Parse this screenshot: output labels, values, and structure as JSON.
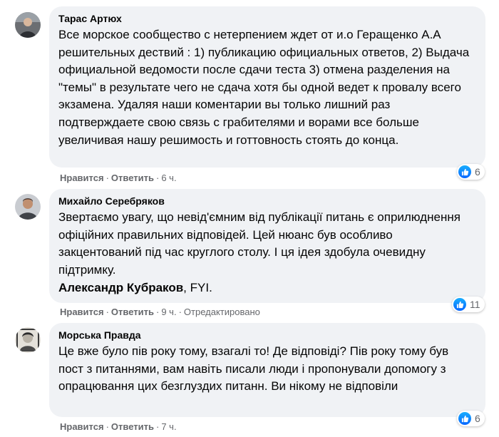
{
  "comments": [
    {
      "author": "Тарас Артюх",
      "text": "Все морское сообщество с нетерпением ждет от и.о Геращенко А.А решительных дествий : 1) публикацию официальных ответов, 2) Выдача официальной ведомости после сдачи теста 3) отмена разделения на \"темы\" в результате чего не сдача хотя бы одной ведет к провалу всего экзамена. Удаляя наши коментарии вы только лишний раз подтверждаете свою связь с грабителями и ворами все больше увеличивая нашу решимость и готтовность стоять до конца.",
      "like_label": "Нравится",
      "reply_label": "Ответить",
      "time": "6 ч.",
      "edited": "",
      "reactions": "6",
      "reaction_icon": "like-icon"
    },
    {
      "author": "Михайло Серебряков",
      "text": "Звертаємо увагу, що невід'ємним від публікації питань є оприлюднення офіційних правильних відповідей. Цей нюанс був особливо закцентований під час круглого столу. І ця ідея здобула очевидну підтримку.",
      "mention": "Александр Кубраков",
      "mention_suffix": ", FYI.",
      "like_label": "Нравится",
      "reply_label": "Ответить",
      "time": "9 ч.",
      "edited": "Отредактировано",
      "reactions": "11",
      "reaction_icon": "like-icon"
    },
    {
      "author": "Морська Правда",
      "text": "Це вже було пів року тому, взагалі то! Де відповіді? Пів року тому був пост з питаннями, вам навіть писали люди і пропонували допомогу з опрацювання цих безглуздих питанн. Ви нікому не відповіли",
      "like_label": "Нравится",
      "reply_label": "Ответить",
      "time": "7 ч.",
      "edited": "",
      "reactions": "6",
      "reaction_icon": "like-icon"
    }
  ],
  "colors": {
    "bubble": "#f0f2f5",
    "meta": "#65676b",
    "like_blue": "#0866ff"
  }
}
